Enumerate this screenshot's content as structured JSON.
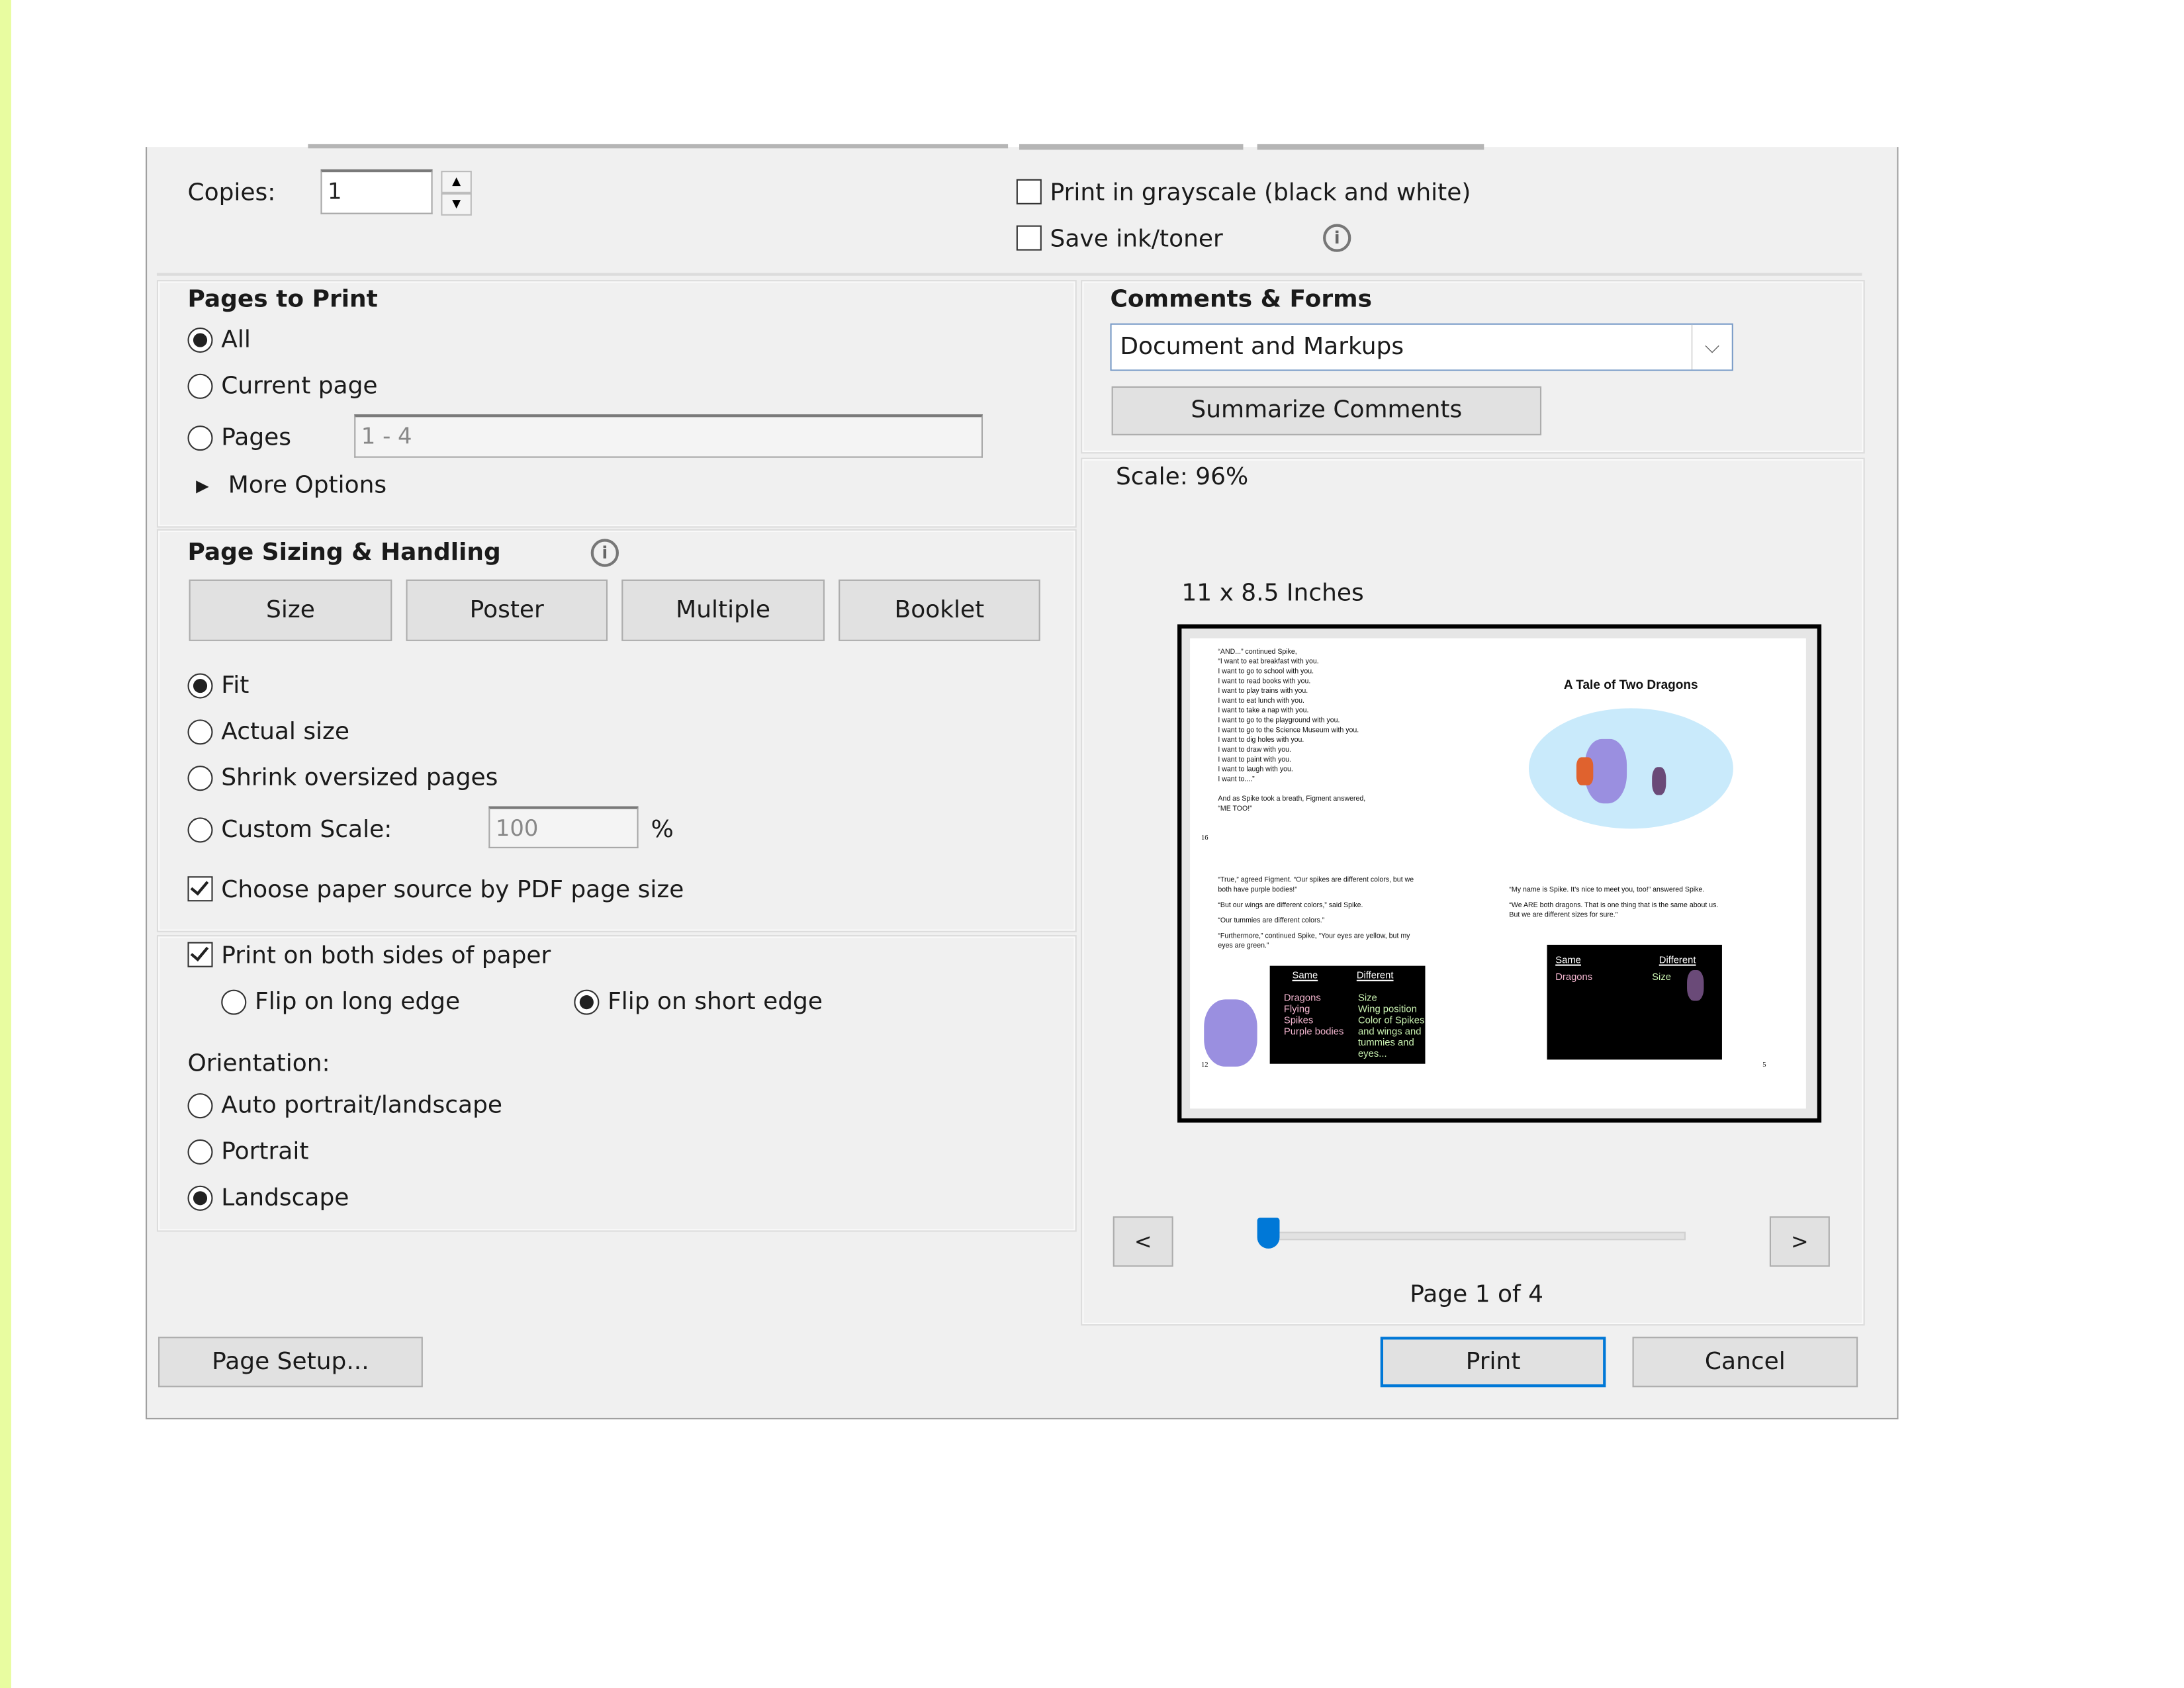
{
  "copies": {
    "label": "Copies:",
    "value": "1"
  },
  "options": {
    "grayscale": {
      "label": "Print in grayscale (black and white)",
      "checked": false
    },
    "save_ink": {
      "label": "Save ink/toner",
      "checked": false
    }
  },
  "pages_to_print": {
    "title": "Pages to Print",
    "all": "All",
    "current": "Current page",
    "pages": "Pages",
    "pages_value": "1 - 4",
    "more_options": "More Options",
    "selected": "All"
  },
  "comments_forms": {
    "title": "Comments & Forms",
    "selected": "Document and Markups",
    "summarize": "Summarize Comments"
  },
  "page_sizing": {
    "title": "Page Sizing & Handling",
    "tabs": [
      "Size",
      "Poster",
      "Multiple",
      "Booklet"
    ],
    "fit": "Fit",
    "actual": "Actual size",
    "shrink": "Shrink oversized pages",
    "custom": "Custom Scale:",
    "custom_value": "100",
    "percent": "%",
    "paper_source": "Choose paper source by PDF page size",
    "selected": "Fit"
  },
  "duplex": {
    "both_sides": "Print on both sides of paper",
    "long_edge": "Flip on long edge",
    "short_edge": "Flip on short edge",
    "selected": "Flip on short edge"
  },
  "orientation": {
    "label": "Orientation:",
    "auto": "Auto portrait/landscape",
    "portrait": "Portrait",
    "landscape": "Landscape",
    "selected": "Landscape"
  },
  "preview": {
    "scale": "Scale:  96%",
    "paper_size": "11 x 8.5 Inches",
    "prev": "<",
    "next": ">",
    "page_status": "Page 1 of 4",
    "slider_position": 1,
    "slider_max": 4,
    "content": {
      "top_left_lines": [
        "“AND...” continued Spike,",
        "“I want to eat breakfast with you.",
        "I want to go to school with you.",
        "I want to read books with you.",
        "I want to play trains with you.",
        "I want to eat lunch with you.",
        "I want to take a nap with you.",
        "I want to go to the playground with you.",
        "I want to go to the Science Museum with you.",
        "I want to dig holes with you.",
        "I want to draw with you.",
        "I want to paint with you.",
        "I want to laugh with you.",
        "I want to....”"
      ],
      "top_left_end": [
        "And as Spike took a breath, Figment answered,",
        "“ME TOO!”"
      ],
      "page_16": "16",
      "title": "A Tale of Two Dragons",
      "bottom_left_lines": [
        "“True,” agreed Figment. “Our spikes are different colors, but we",
        "both have purple bodies!”",
        "“But our wings are different colors,” said Spike.",
        "“Our tummies are different colors.”",
        "“Furthermore,” continued Spike, “Your eyes are yellow, but my",
        "eyes are green.”"
      ],
      "chart1": {
        "same": "Same",
        "different": "Different",
        "same_items": [
          "Dragons",
          "Flying",
          "Spikes",
          "Purple bodies"
        ],
        "diff_items": [
          "Size",
          "Wing position",
          "Color of Spikes",
          "and wings and",
          "tummies and",
          "eyes..."
        ]
      },
      "page_12": "12",
      "bottom_right_lines": [
        "“My name is Spike. It’s nice to meet you, too!” answered Spike.",
        "“We ARE both dragons. That is one thing that is the same about us.",
        "But we are different sizes for sure.”"
      ],
      "chart2": {
        "same": "Same",
        "different": "Different",
        "same_items": [
          "Dragons"
        ],
        "diff_items": [
          "Size"
        ]
      },
      "page_5": "5"
    }
  },
  "buttons": {
    "page_setup": "Page Setup...",
    "print": "Print",
    "cancel": "Cancel"
  },
  "colors": {
    "accent": "#0078d7",
    "dialog_bg": "#f0f0f0",
    "strip": "#e8fca0"
  }
}
